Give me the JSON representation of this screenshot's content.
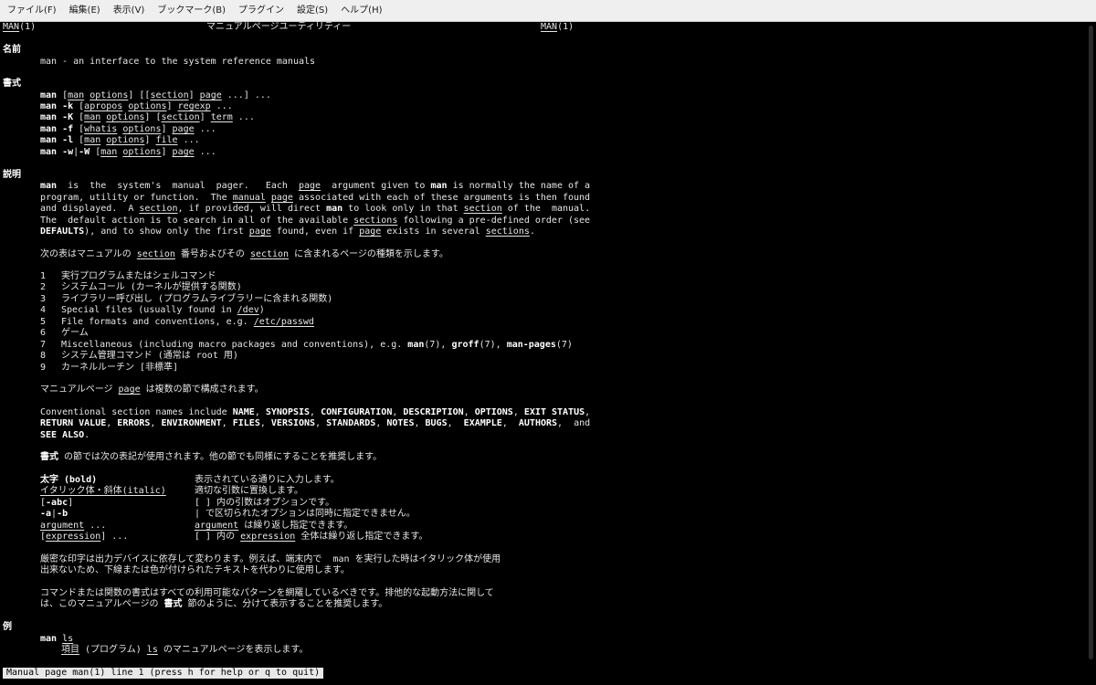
{
  "menubar": {
    "items": [
      "ファイル(F)",
      "編集(E)",
      "表示(V)",
      "ブックマーク(B)",
      "プラグイン",
      "設定(S)",
      "ヘルプ(H)"
    ]
  },
  "header": {
    "left_name": "MAN",
    "left_sect": "(1)",
    "center": "マニュアルページユーティリティー",
    "right_name": "MAN",
    "right_sect": "(1)"
  },
  "sections": {
    "name": "名前",
    "synopsis": "書式",
    "description": "説明",
    "examples": "例"
  },
  "content": {
    "name_line": "man - an interface to the system reference manuals",
    "synopsis": {
      "l1": [
        "man",
        " [",
        "man",
        " ",
        "options",
        "] [[",
        "section",
        "] ",
        "page",
        " ...] ..."
      ],
      "l2": [
        "man -k",
        " [",
        "apropos",
        " ",
        "options",
        "] ",
        "regexp",
        " ..."
      ],
      "l3": [
        "man -K",
        " [",
        "man",
        " ",
        "options",
        "] [",
        "section",
        "] ",
        "term",
        " ..."
      ],
      "l4": [
        "man -f",
        " [",
        "whatis",
        " ",
        "options",
        "] ",
        "page",
        " ..."
      ],
      "l5": [
        "man -l",
        " [",
        "man",
        " ",
        "options",
        "] ",
        "file",
        " ..."
      ],
      "l6": [
        "man -w",
        "|",
        "-W",
        " [",
        "man",
        " ",
        "options",
        "] ",
        "page",
        " ..."
      ]
    },
    "desc": {
      "p1l1": [
        "man",
        "  is  the  system's  manual  pager.   Each  ",
        "page",
        "  argument given to ",
        "man",
        " is normally the name of a"
      ],
      "p1l2": [
        "program, utility or function.  The ",
        "manual",
        " ",
        "page",
        " associated with each of these arguments is then found"
      ],
      "p1l3": [
        "and displayed.  A ",
        "section",
        ", if provided, will direct ",
        "man",
        " to look only in that ",
        "section",
        " of the  manual."
      ],
      "p1l4": [
        "The  default action is to search in all of the available ",
        "sections",
        " following a pre-defined order (see"
      ],
      "p1l5": [
        "DEFAULTS",
        "), and to show only the first ",
        "page",
        " found, even if ",
        "page",
        " exists in several ",
        "sections",
        "."
      ],
      "p2": [
        "次の表はマニュアルの ",
        "section",
        " 番号およびその ",
        "section",
        " に含まれるページの種類を示します。"
      ],
      "table": [
        [
          "1",
          "実行プログラムまたはシェルコマンド"
        ],
        [
          "2",
          "システムコール (カーネルが提供する関数)"
        ],
        [
          "3",
          "ライブラリー呼び出し (プログラムライブラリーに含まれる関数)"
        ],
        [
          "4",
          "Special files (usually found in ",
          "/dev",
          ")"
        ],
        [
          "5",
          "File formats and conventions, e.g. ",
          "/etc/passwd"
        ],
        [
          "6",
          "ゲーム"
        ],
        [
          "7",
          "Miscellaneous (including macro packages and conventions), e.g. ",
          "man",
          "(7), ",
          "groff",
          "(7), ",
          "man-pages",
          "(7)"
        ],
        [
          "8",
          "システム管理コマンド (通常は root 用)"
        ],
        [
          "9",
          "カーネルルーチン [非標準]"
        ]
      ],
      "p3": [
        "マニュアルページ ",
        "page",
        " は複数の節で構成されます。"
      ],
      "p4l1": [
        "Conventional section names include ",
        "NAME",
        ", ",
        "SYNOPSIS",
        ", ",
        "CONFIGURATION",
        ", ",
        "DESCRIPTION",
        ", ",
        "OPTIONS",
        ", ",
        "EXIT STATUS",
        ","
      ],
      "p4l2": [
        "RETURN VALUE",
        ", ",
        "ERRORS",
        ", ",
        "ENVIRONMENT",
        ", ",
        "FILES",
        ", ",
        "VERSIONS",
        ", ",
        "STANDARDS",
        ", ",
        "NOTES",
        ", ",
        "BUGS",
        ",  ",
        "EXAMPLE",
        ",  ",
        "AUTHORS",
        ",  and"
      ],
      "p4l3": [
        "SEE ALSO",
        "."
      ],
      "p5": [
        "書式",
        " の節では次の表記が使用されます。他の節でも同様にすることを推奨します。"
      ],
      "conv": {
        "r1": [
          "太字 (bold)",
          "表示されている通りに入力します。"
        ],
        "r2": [
          "イタリック体・斜体(italic)",
          "適切な引数に置換します。"
        ],
        "r3": [
          "[",
          "-abc",
          "]",
          "[ ] 内の引数はオプションです。"
        ],
        "r4": [
          "-a",
          "|",
          "-b",
          "| で区切られたオプションは同時に指定できません。"
        ],
        "r5": [
          "argument",
          " ...",
          "argument",
          " は繰り返し指定できます。"
        ],
        "r6": [
          "[",
          "expression",
          "] ...",
          "[ ] 内の ",
          "expression",
          " 全体は繰り返し指定できます。"
        ]
      },
      "p6l1": "厳密な印字は出力デバイスに依存して変わります。例えば、端末内で  man を実行した時はイタリック体が使用",
      "p6l2": "出来ないため、下線または色が付けられたテキストを代わりに使用します。",
      "p7l1": "コマンドまたは関数の書式はすべての利用可能なパターンを網羅しているべきです。排他的な起動方法に関して",
      "p7l2": [
        "は、このマニュアルページの ",
        "書式",
        " 節のように、分けて表示することを推奨します。"
      ]
    },
    "examples": {
      "cmd": [
        "man",
        " ",
        "ls"
      ],
      "desc": [
        "項目",
        " (プログラム) ",
        "ls",
        " のマニュアルページを表示します。"
      ]
    }
  },
  "status_line": "Manual page man(1) line 1 (press h for help or q to quit)"
}
